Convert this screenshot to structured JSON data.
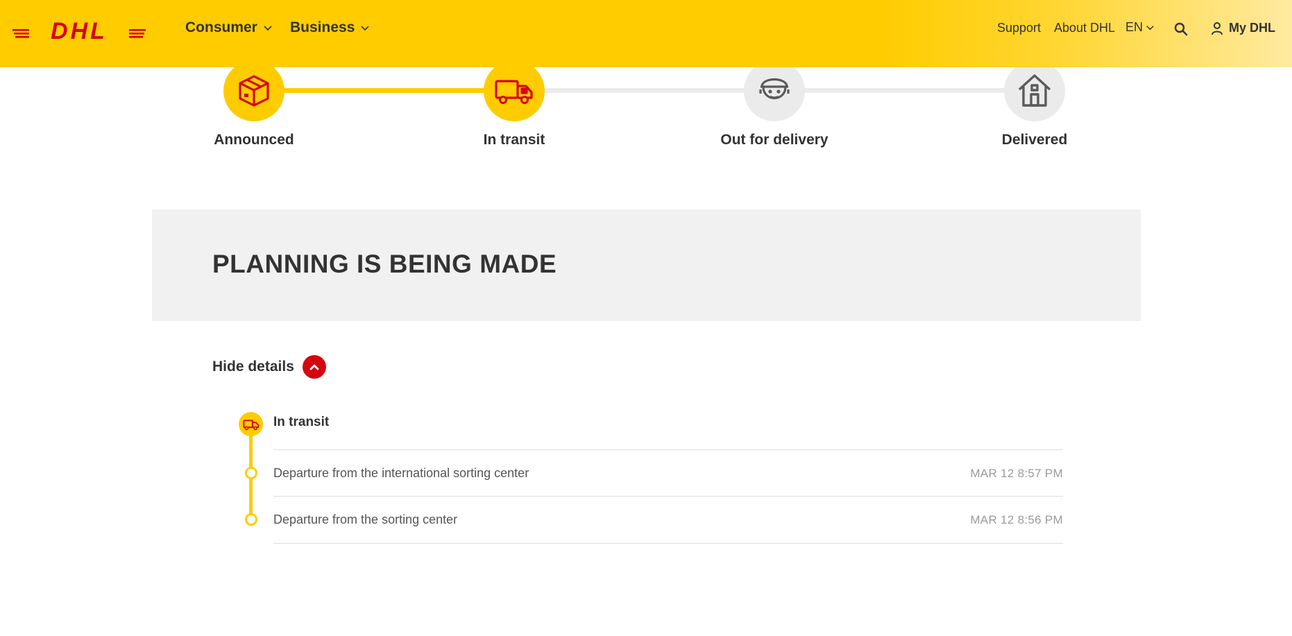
{
  "header": {
    "logo_text": "DHL",
    "nav": [
      {
        "label": "Consumer"
      },
      {
        "label": "Business"
      }
    ],
    "utility": {
      "support": "Support",
      "about": "About DHL",
      "language": "EN",
      "my_dhl": "My DHL"
    }
  },
  "progress": {
    "steps": [
      {
        "label": "Announced",
        "icon": "package-icon",
        "state": "done"
      },
      {
        "label": "In transit",
        "icon": "truck-icon",
        "state": "current"
      },
      {
        "label": "Out for delivery",
        "icon": "courier-icon",
        "state": "pending"
      },
      {
        "label": "Delivered",
        "icon": "house-icon",
        "state": "pending"
      }
    ]
  },
  "status": {
    "title": "PLANNING IS BEING MADE"
  },
  "details": {
    "toggle_label": "Hide details",
    "group_label": "In transit",
    "events": [
      {
        "description": "Departure from the international sorting center",
        "time": "MAR 12 8:57 PM"
      },
      {
        "description": "Departure from the sorting center",
        "time": "MAR 12 8:56 PM"
      }
    ]
  },
  "colors": {
    "brand_yellow": "#ffcc00",
    "brand_red": "#d40511",
    "inactive_grey": "#ebebeb",
    "panel_grey": "#f1f1f1"
  }
}
